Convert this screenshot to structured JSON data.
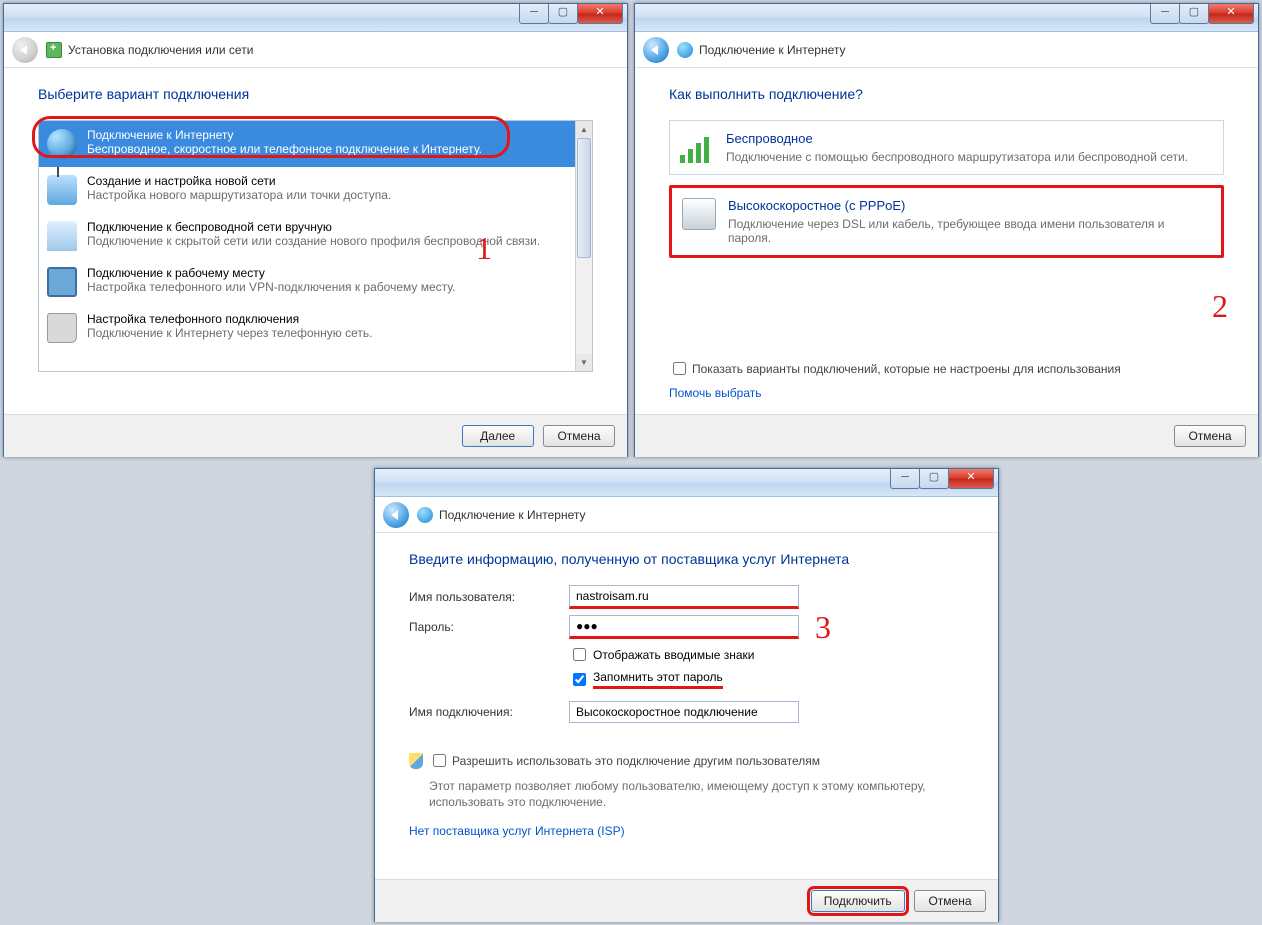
{
  "win1": {
    "nav_title": "Установка подключения или сети",
    "heading": "Выберите вариант подключения",
    "options": [
      {
        "title": "Подключение к Интернету",
        "desc": "Беспроводное, скоростное или телефонное подключение к Интернету."
      },
      {
        "title": "Создание и настройка новой сети",
        "desc": "Настройка нового маршрутизатора или точки доступа."
      },
      {
        "title": "Подключение к беспроводной сети вручную",
        "desc": "Подключение к скрытой сети или создание нового профиля беспроводной связи."
      },
      {
        "title": "Подключение к рабочему месту",
        "desc": "Настройка телефонного или VPN-подключения к рабочему месту."
      },
      {
        "title": "Настройка телефонного подключения",
        "desc": "Подключение к Интернету через телефонную сеть."
      }
    ],
    "next_btn": "Далее",
    "cancel_btn": "Отмена",
    "num": "1"
  },
  "win2": {
    "nav_title": "Подключение к Интернету",
    "heading": "Как выполнить подключение?",
    "card1": {
      "title": "Беспроводное",
      "desc": "Подключение с помощью беспроводного маршрутизатора или беспроводной сети."
    },
    "card2": {
      "title": "Высокоскоростное (с PPPoE)",
      "desc": "Подключение через DSL или кабель, требующее ввода имени пользователя и пароля."
    },
    "show_more_label": "Показать варианты подключений, которые не настроены для использования",
    "help_link": "Помочь выбрать",
    "cancel_btn": "Отмена",
    "num": "2"
  },
  "win3": {
    "nav_title": "Подключение к Интернету",
    "heading": "Введите информацию, полученную от поставщика услуг Интернета",
    "user_label": "Имя пользователя:",
    "user_value": "nastroisam.ru",
    "pass_label": "Пароль:",
    "pass_value": "●●●",
    "show_chars": "Отображать вводимые знаки",
    "remember": "Запомнить этот пароль",
    "conn_label": "Имя подключения:",
    "conn_value": "Высокоскоростное подключение",
    "allow_label": "Разрешить использовать это подключение другим пользователям",
    "allow_hint": "Этот параметр позволяет любому пользователю, имеющему доступ к этому компьютеру, использовать это подключение.",
    "isp_link": "Нет поставщика услуг Интернета (ISP)",
    "connect_btn": "Подключить",
    "cancel_btn": "Отмена",
    "num": "3"
  }
}
